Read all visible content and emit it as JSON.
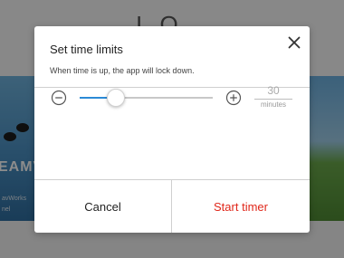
{
  "background": {
    "heading_fragment": "I O",
    "left_thumb_word": "EAMV",
    "left_thumb_line1": "avWorks",
    "left_thumb_line2": "nel"
  },
  "dialog": {
    "title": "Set time limits",
    "subtitle": "When time is up, the app will lock down.",
    "close_icon": "close-icon",
    "slider": {
      "value": 30,
      "min": 0,
      "max": 180,
      "fill_fraction": 0.27,
      "accent_color": "#2b8ad6",
      "decrease_icon": "minus-circle-icon",
      "increase_icon": "plus-circle-icon"
    },
    "minutes": {
      "value": "30",
      "unit": "minutes"
    },
    "cancel_label": "Cancel",
    "start_label": "Start timer",
    "start_color": "#e0271a"
  }
}
